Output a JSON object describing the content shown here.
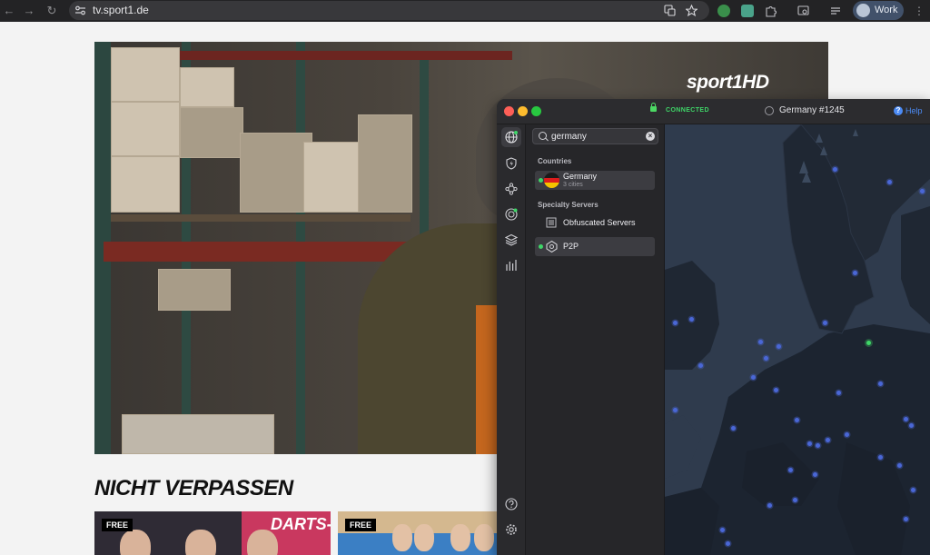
{
  "browser": {
    "url": "tv.sport1.de",
    "profile_label": "Work"
  },
  "page": {
    "channel_logo": "sport1HD",
    "section_title": "NICHT VERPASSEN",
    "cards": [
      {
        "badge": "FREE",
        "headline": "DARTS-"
      },
      {
        "badge": "FREE"
      }
    ]
  },
  "vpn": {
    "status": "CONNECTED",
    "server": "Germany #1245",
    "help_label": "Help",
    "search": {
      "value": "germany"
    },
    "countries_heading": "Countries",
    "countries": [
      {
        "name": "Germany",
        "sub": "3 cities"
      }
    ],
    "specialty_heading": "Specialty Servers",
    "specialty": [
      {
        "name": "Obfuscated Servers"
      },
      {
        "name": "P2P"
      }
    ],
    "colors": {
      "accent": "#4c8bf5",
      "connected": "#3fd668",
      "map": "#2f3b4d"
    }
  }
}
